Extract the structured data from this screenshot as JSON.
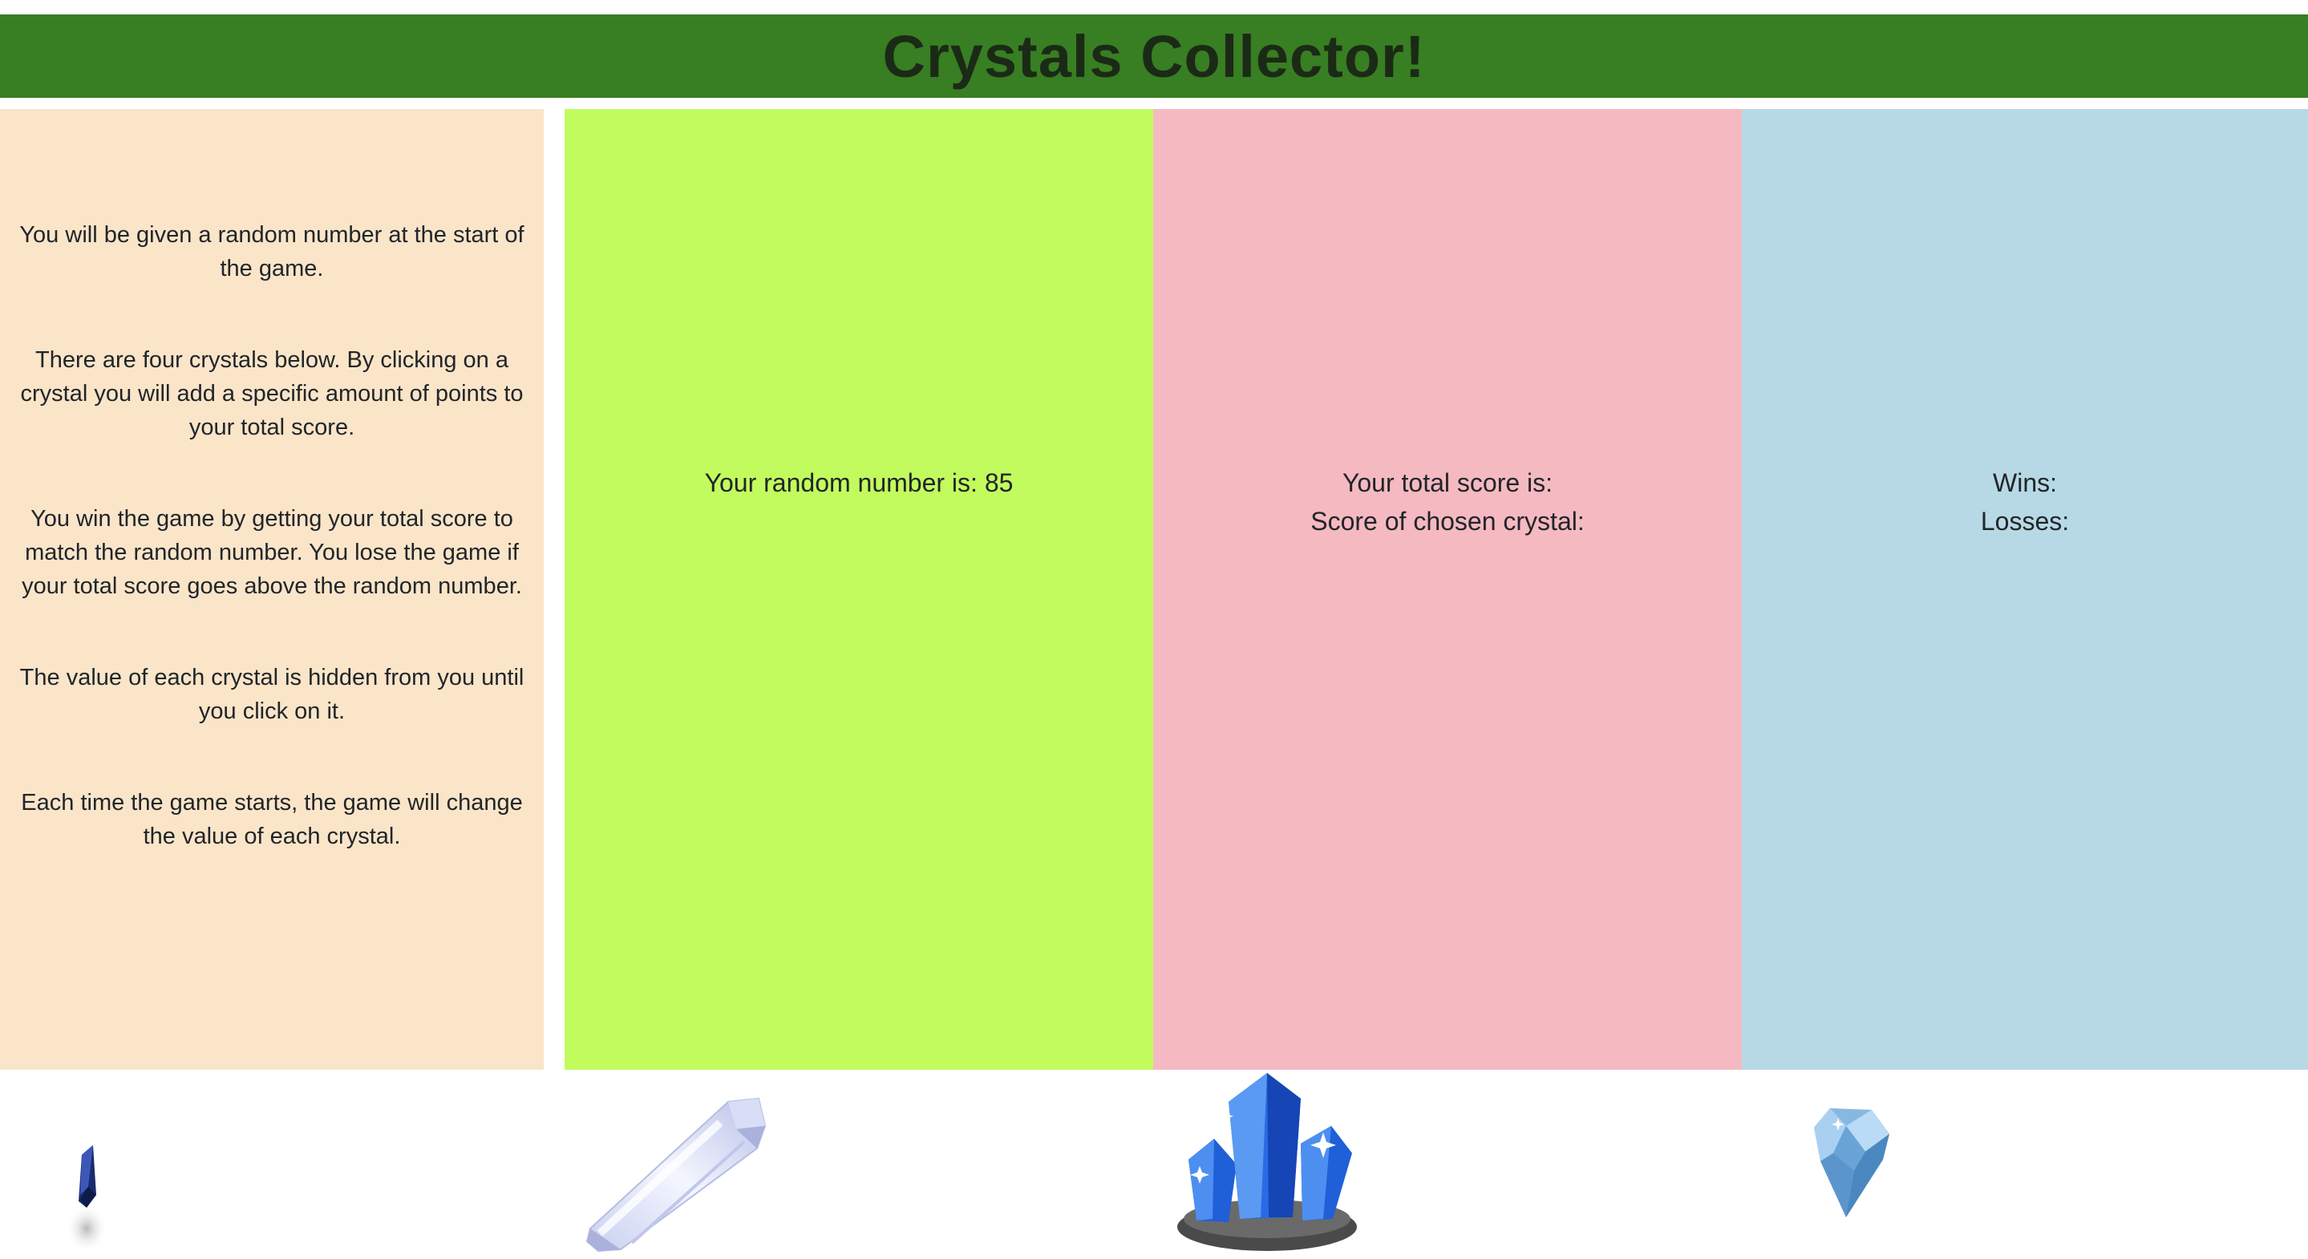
{
  "header": {
    "title": "Crystals Collector!"
  },
  "instructions": [
    "You will be given a random number at the start of the game.",
    "There are four crystals below. By clicking on a crystal you will add a specific amount of points to your total score.",
    "You win the game by getting your total score to match the random number. You lose the game if your total score goes above the random number.",
    "The value of each crystal is hidden from you until you click on it.",
    "Each time the game starts, the game will change the value of each crystal."
  ],
  "random": {
    "label": "Your random number is: 85"
  },
  "score": {
    "total_label": "Your total score is:",
    "chosen_label": "Score of chosen crystal:"
  },
  "record": {
    "wins_label": "Wins:",
    "losses_label": "Losses:"
  },
  "crystals": [
    {
      "icon": "dark-blue-crystal-icon"
    },
    {
      "icon": "clear-quartz-crystal-icon"
    },
    {
      "icon": "blue-crystal-cluster-icon"
    },
    {
      "icon": "light-blue-gem-icon"
    }
  ],
  "colors": {
    "header": "#387e22",
    "instructions_bg": "#fae5c9",
    "random_bg": "#c2fb5d",
    "score_bg": "#f5b9c1",
    "record_bg": "#b7d9e5"
  }
}
